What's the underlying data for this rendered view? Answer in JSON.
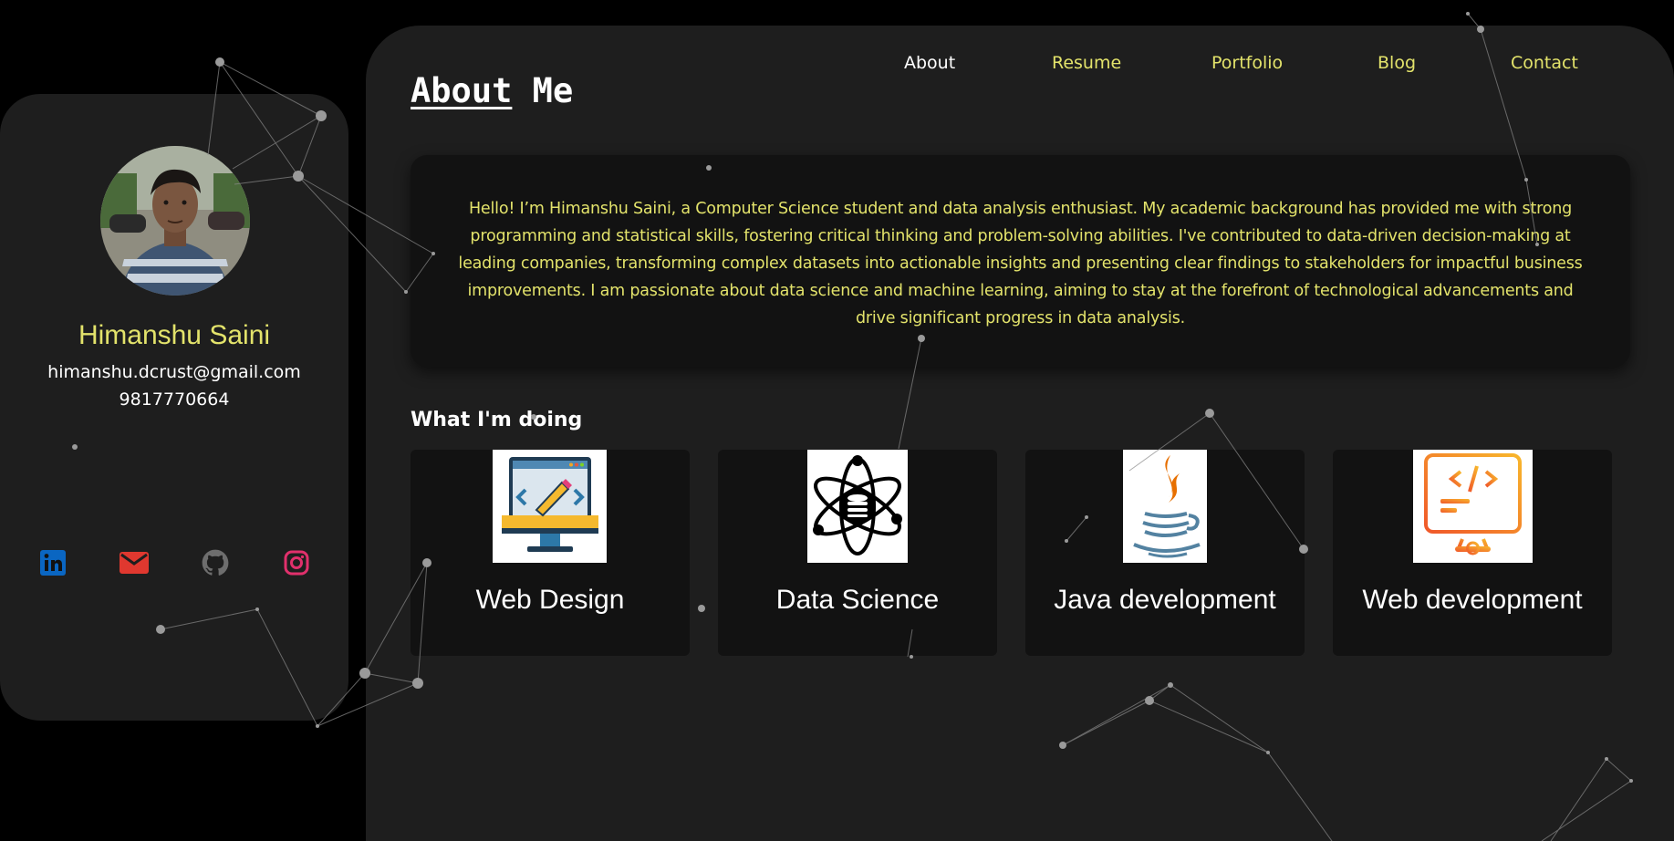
{
  "profile": {
    "name": "Himanshu Saini",
    "email": "himanshu.dcrust@gmail.com",
    "phone": "9817770664",
    "avatar_icon": "profile-photo"
  },
  "social": [
    {
      "icon": "linkedin-icon",
      "color": "#0a66c2"
    },
    {
      "icon": "mail-icon",
      "color": "#e0382f"
    },
    {
      "icon": "github-icon",
      "color": "#6e6e6e"
    },
    {
      "icon": "instagram-icon",
      "color": "#e1306c"
    }
  ],
  "nav": {
    "about": "About",
    "resume": "Resume",
    "portfolio": "Portfolio",
    "blog": "Blog",
    "contact": "Contact"
  },
  "page": {
    "title_part1": "About",
    "title_part2": "Me"
  },
  "about": {
    "text": "Hello! I’m Himanshu Saini, a Computer Science student and data analysis enthusiast. My academic background has provided me with strong programming and statistical skills, fostering critical thinking and problem-solving abilities. I've contributed to data-driven decision-making at leading companies, transforming complex datasets into actionable insights and presenting clear findings to stakeholders for impactful business improvements. I am passionate about data science and machine learning, aiming to stay at the forefront of technological advancements and drive significant progress in data analysis."
  },
  "services": {
    "heading": "What I'm doing",
    "items": [
      {
        "label": "Web Design",
        "icon": "web-design-icon"
      },
      {
        "label": "Data Science",
        "icon": "data-science-icon"
      },
      {
        "label": "Java development",
        "icon": "java-icon"
      },
      {
        "label": "Web development",
        "icon": "web-development-icon"
      }
    ]
  },
  "colors": {
    "accent": "#e3e36b",
    "page_bg": "#000000",
    "panel_bg": "#1e1e1e",
    "card_bg": "#121212"
  }
}
